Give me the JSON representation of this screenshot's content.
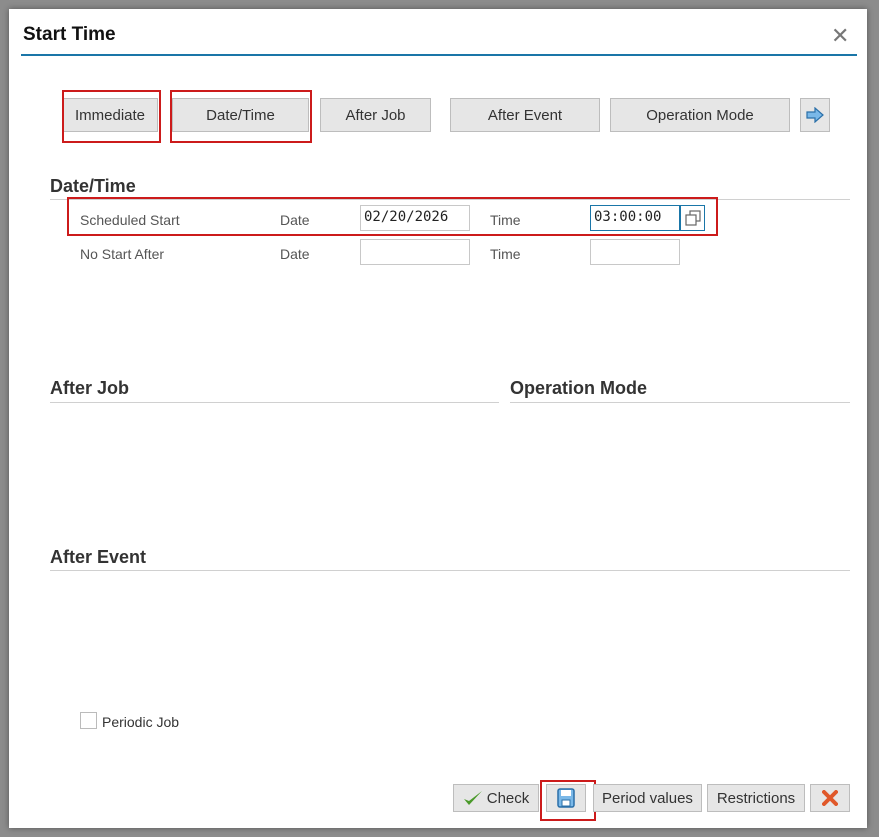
{
  "dialog": {
    "title": "Start Time"
  },
  "toolbar": {
    "immediate": "Immediate",
    "date_time": "Date/Time",
    "after_job": "After Job",
    "after_event": "After Event",
    "operation_mode": "Operation Mode"
  },
  "date_time": {
    "heading": "Date/Time",
    "scheduled_start": {
      "label": "Scheduled Start",
      "date_label": "Date",
      "date_value": "02/20/2026",
      "time_label": "Time",
      "time_value": "03:00:00"
    },
    "no_start_after": {
      "label": "No Start After",
      "date_label": "Date",
      "date_value": "",
      "time_label": "Time",
      "time_value": ""
    }
  },
  "sections": {
    "after_job": "After Job",
    "operation_mode": "Operation Mode",
    "after_event": "After Event"
  },
  "periodic_job": {
    "label": "Periodic Job",
    "checked": false
  },
  "footer": {
    "check": "Check",
    "period_values": "Period values",
    "restrictions": "Restrictions"
  },
  "colors": {
    "accent": "#1a76a8",
    "highlight": "#cc1b1b",
    "cancel": "#e0582a",
    "check": "#4a9a2a"
  }
}
